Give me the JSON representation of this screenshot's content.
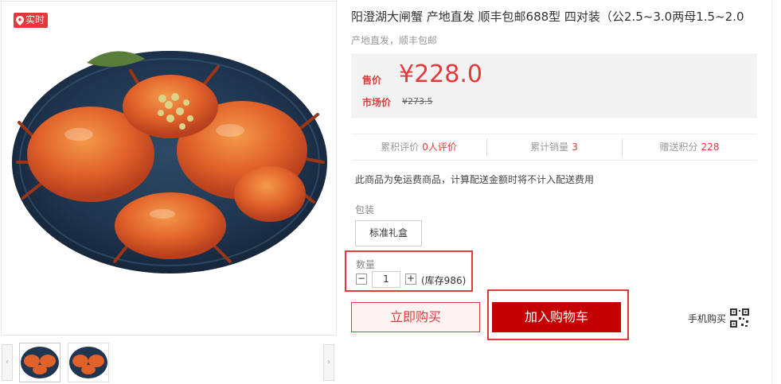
{
  "gallery": {
    "badge_label": "实时",
    "badge_icon": "location-pin-icon",
    "prev_icon": "chevron-left-icon",
    "next_icon": "chevron-right-icon"
  },
  "product": {
    "title": "阳澄湖大闸蟹 产地直发 顺丰包邮688型 四对装（公2.5~3.0两母1.5~2.0",
    "subtitle": "产地直发，顺丰包邮",
    "price_label": "售价",
    "price": "¥228.0",
    "market_label": "市场价",
    "market_price": "¥273.5"
  },
  "stats": {
    "reviews_label": "累积评价",
    "reviews_value": "0人评价",
    "sales_label": "累计销量",
    "sales_value": "3",
    "points_label": "赠送积分",
    "points_value": "228"
  },
  "freight_note": "此商品为免运费商品，计算配送金额时将不计入配送费用",
  "packaging": {
    "label": "包装",
    "option": "标准礼盒"
  },
  "quantity": {
    "label": "数量",
    "minus": "−",
    "value": "1",
    "plus": "+",
    "stock": "(库存986)"
  },
  "actions": {
    "buy_now": "立即购买",
    "add_to_cart": "加入购物车",
    "mobile_buy": "手机购买",
    "qr_icon": "qr-code-icon"
  },
  "colors": {
    "accent": "#e4393c",
    "cart_button": "#c40000"
  }
}
